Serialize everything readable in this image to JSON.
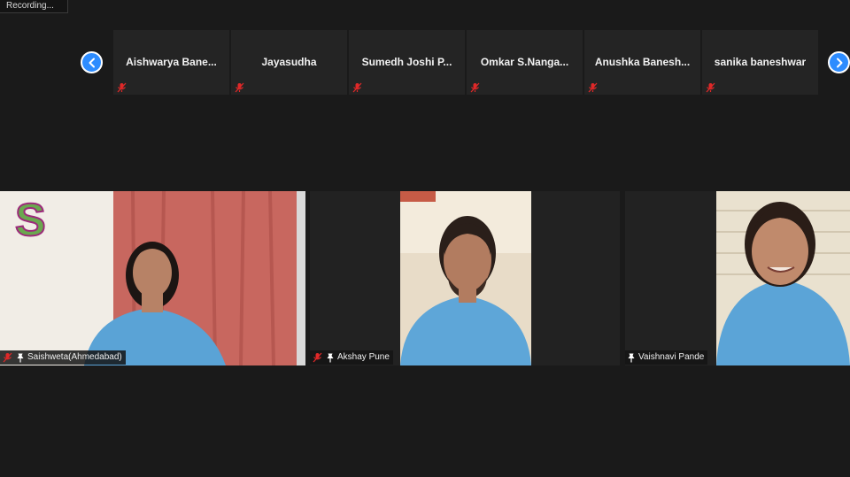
{
  "recording": {
    "label": "Recording..."
  },
  "strip": {
    "participants": [
      {
        "name": "Aishwarya  Bane..."
      },
      {
        "name": "Jayasudha"
      },
      {
        "name": "Sumedh  Joshi   P..."
      },
      {
        "name": "Omkar  S.Nanga..."
      },
      {
        "name": "Anushka  Banesh..."
      },
      {
        "name": "sanika baneshwar"
      }
    ]
  },
  "gallery": {
    "tiles": [
      {
        "name": "Saishweta(Ahmedabad)"
      },
      {
        "name": "Akshay Pune"
      },
      {
        "name": "Vaishnavi Pande"
      }
    ]
  },
  "colors": {
    "accent": "#2d8cff",
    "muted": "#e02828"
  }
}
